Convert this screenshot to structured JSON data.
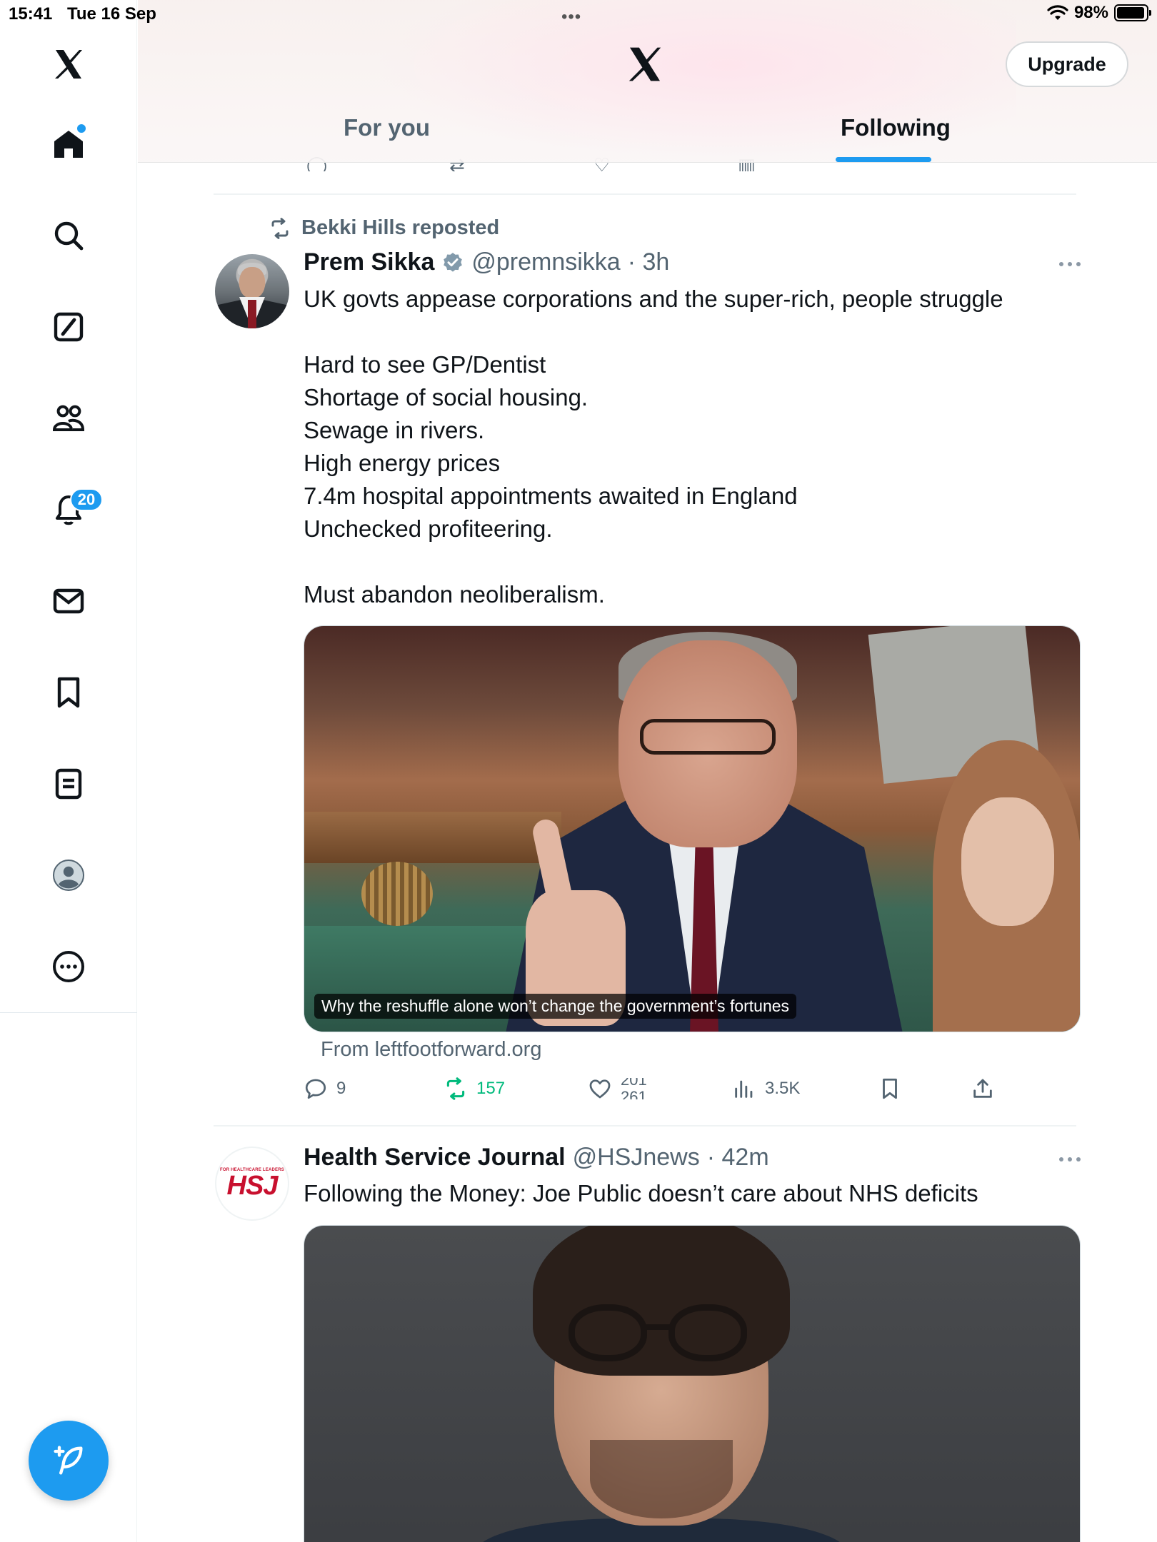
{
  "status_bar": {
    "time": "15:41",
    "date": "Tue 16 Sep",
    "battery_text": "98%",
    "battery_level": 0.98,
    "dots": "•••"
  },
  "sidebar": {
    "items": [
      "x-logo",
      "home",
      "search",
      "grok",
      "communities",
      "notifications",
      "messages",
      "bookmarks",
      "lists",
      "profile",
      "more"
    ],
    "notification_count": "20"
  },
  "header": {
    "upgrade_label": "Upgrade",
    "tabs": [
      {
        "label": "For you",
        "active": false
      },
      {
        "label": "Following",
        "active": true
      }
    ]
  },
  "colors": {
    "accent": "#1d9bf0",
    "retweet_green": "#00ba7c",
    "secondary_text": "#536471"
  },
  "tweets": [
    {
      "repost_label": "Bekki Hills reposted",
      "author_name": "Prem Sikka",
      "verified": true,
      "handle": "@premnsikka",
      "time": "· 3h",
      "text": "UK govts appease corporations and the super-rich, people struggle\n\nHard to see GP/Dentist\nShortage of social housing.\nSewage in rivers.\nHigh energy prices\n7.4m hospital appointments awaited in England\nUnchecked profiteering.\n\nMust abandon neoliberalism.",
      "media_caption": "Why the reshuffle alone won’t change the government’s fortunes",
      "source": "From leftfootforward.org",
      "replies": "9",
      "retweets": "157",
      "likes_old": "201",
      "likes_new": "261",
      "views": "3.5K"
    },
    {
      "author_name": "Health Service Journal",
      "handle": "@HSJnews",
      "time": "· 42m",
      "text": "Following the Money: Joe Public doesn’t care about NHS deficits",
      "avatar_small_text": "FOR HEALTHCARE LEADERS",
      "avatar_big_text": "HSJ"
    }
  ]
}
